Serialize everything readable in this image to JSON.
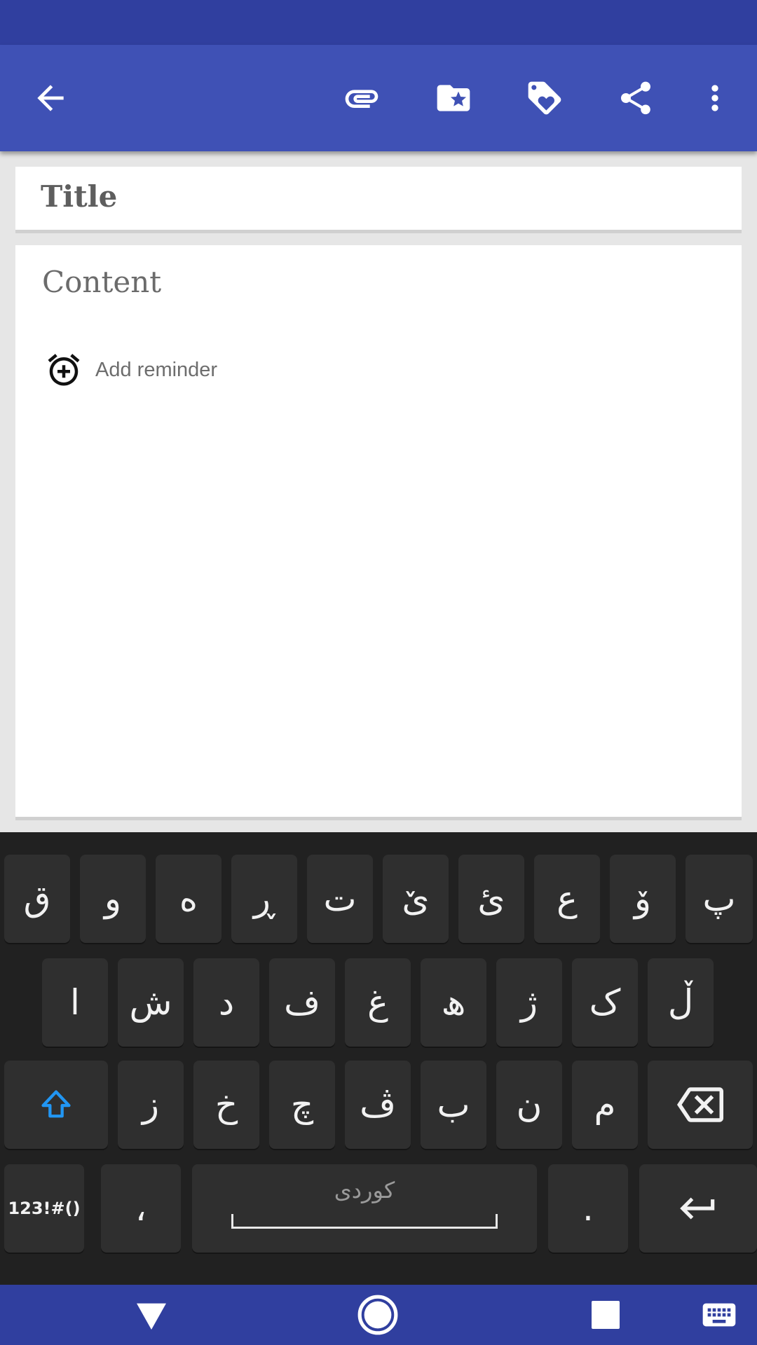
{
  "toolbar": {
    "icons": [
      "back-arrow-icon",
      "attachment-icon",
      "folder-star-icon",
      "tag-heart-icon",
      "share-icon",
      "more-vert-icon"
    ],
    "color": "#3f51b5",
    "status_color": "#303f9f"
  },
  "note": {
    "title_placeholder": "Title",
    "content_placeholder": "Content",
    "reminder_label": "Add reminder"
  },
  "keyboard": {
    "row1": [
      "ق",
      "و",
      "ە",
      "ڕ",
      "ت",
      "ێ",
      "ئ",
      "ع",
      "ۆ",
      "پ"
    ],
    "row2": [
      "ا",
      "ش",
      "د",
      "ف",
      "غ",
      "ھ",
      "ژ",
      "ک",
      "ڵ"
    ],
    "row3": [
      "ز",
      "خ",
      "چ",
      "ڤ",
      "ب",
      "ن",
      "م"
    ],
    "symbols_label": "123!#()",
    "comma": "،",
    "space_language": "کوردی",
    "period": ".",
    "accent_color": "#2196f3"
  },
  "navbar": {
    "icons": [
      "back-triangle-icon",
      "home-circle-icon",
      "recents-square-icon",
      "keyboard-icon"
    ]
  }
}
